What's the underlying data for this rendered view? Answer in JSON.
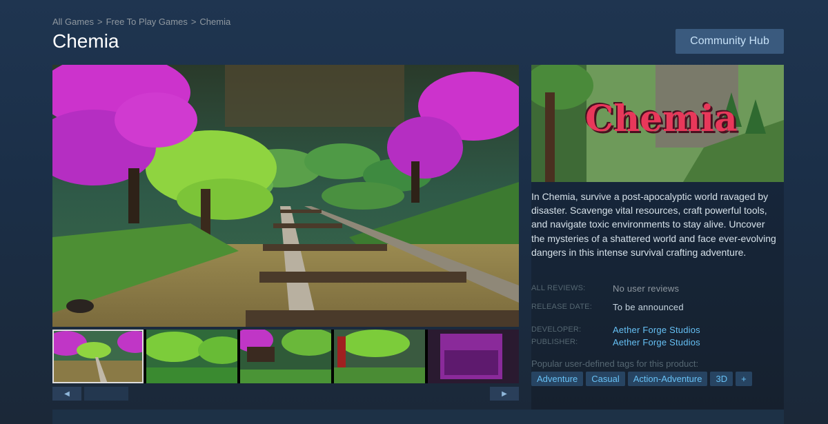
{
  "breadcrumb": [
    "All Games",
    "Free To Play Games",
    "Chemia"
  ],
  "breadcrumb_sep": ">",
  "title": "Chemia",
  "community_hub_label": "Community Hub",
  "capsule_logo_text": "Chemia",
  "description": "In Chemia, survive a post-apocalyptic world ravaged by disaster. Scavenge vital resources, craft powerful tools, and navigate toxic environments to stay alive. Uncover the mysteries of a shattered world and face ever-evolving dangers in this intense survival crafting adventure.",
  "info": {
    "reviews_label": "ALL REVIEWS:",
    "reviews_value": "No user reviews",
    "release_label": "RELEASE DATE:",
    "release_value": "To be announced",
    "developer_label": "DEVELOPER:",
    "developer_value": "Aether Forge Studios",
    "publisher_label": "PUBLISHER:",
    "publisher_value": "Aether Forge Studios"
  },
  "tags_label": "Popular user-defined tags for this product:",
  "tags": [
    "Adventure",
    "Casual",
    "Action-Adventure",
    "3D",
    "+"
  ],
  "scroll": {
    "left_icon": "◀",
    "right_icon": "▶"
  },
  "colors": {
    "link": "#66c0f4",
    "tag_bg": "#274462",
    "button_bg": "#3a5a7e"
  }
}
